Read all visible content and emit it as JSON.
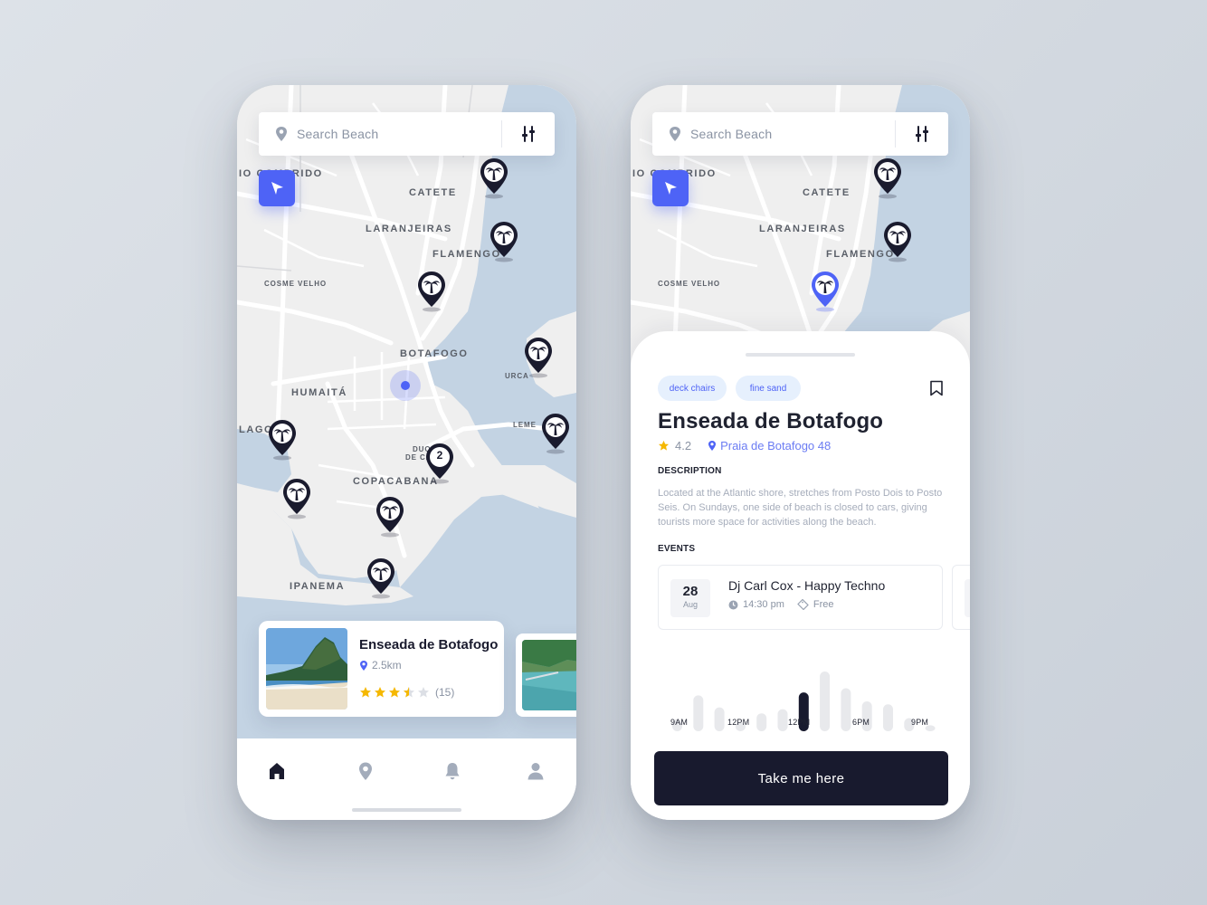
{
  "colors": {
    "accent": "#4e63f6",
    "marker": "#1a1b2e",
    "water": "#c3d3e3",
    "land": "#efefef",
    "road": "#ffffff",
    "cta_bg": "#181a2e",
    "chip_bg": "#e6f0fd",
    "star": "#f5b800"
  },
  "search": {
    "placeholder": "Search Beach",
    "icon": "location-pin-icon",
    "filter_icon": "sliders-icon"
  },
  "map": {
    "labels": {
      "rio_comprido": "IO COMPRIDO",
      "catete": "CATETE",
      "laranjeiras": "LARANJEIRAS",
      "flamengo": "FLAMENGO",
      "cosme_velho": "COSME VELHO",
      "botafogo": "BOTAFOGO",
      "urca": "URCA",
      "humaita": "HUMAITÁ",
      "lagoa": "LAGO",
      "leme": "LEME",
      "duque": "DUQ",
      "duque2": "DE CA",
      "copacabana": "COPACABANA",
      "ipanema": "IPANEMA"
    },
    "cluster_count": "2",
    "marker_icon": "palm-tree-icon"
  },
  "left": {
    "card": {
      "name": "Enseada de Botafogo",
      "distance": "2.5km",
      "rating_stars": 3.5,
      "reviews": "(15)"
    },
    "tabs": [
      {
        "name": "home",
        "icon": "home-icon",
        "active": true
      },
      {
        "name": "map",
        "icon": "location-pin-icon",
        "active": false
      },
      {
        "name": "notifications",
        "icon": "bell-icon",
        "active": false
      },
      {
        "name": "profile",
        "icon": "user-icon",
        "active": false
      }
    ]
  },
  "right": {
    "chips": [
      "deck chairs",
      "fine sand"
    ],
    "title": "Enseada de Botafogo",
    "rating": "4.2",
    "address": "Praia de Botafogo 48",
    "description_label": "DESCRIPTION",
    "description": "Located at the Atlantic shore, stretches from Posto Dois to Posto Seis. On Sundays, one side of beach is closed to cars, giving tourists more space for activities along the beach.",
    "events_label": "EVENTS",
    "event": {
      "day": "28",
      "month": "Aug",
      "name": "Dj Carl Cox - Happy Techno",
      "time": "14:30 pm",
      "price": "Free"
    },
    "chart_data": {
      "type": "bar",
      "values": [
        0.2,
        0.6,
        0.4,
        0.15,
        0.3,
        0.37,
        0.65,
        1.0,
        0.72,
        0.5,
        0.45,
        0.22,
        0.1
      ],
      "highlight_index": 6,
      "tick_labels": [
        "9AM",
        "12PM",
        "12PM",
        "6PM",
        "9PM"
      ],
      "colors": {
        "bar": "#e8e9ec",
        "highlight": "#181a2e"
      }
    },
    "cta_label": "Take me here"
  }
}
